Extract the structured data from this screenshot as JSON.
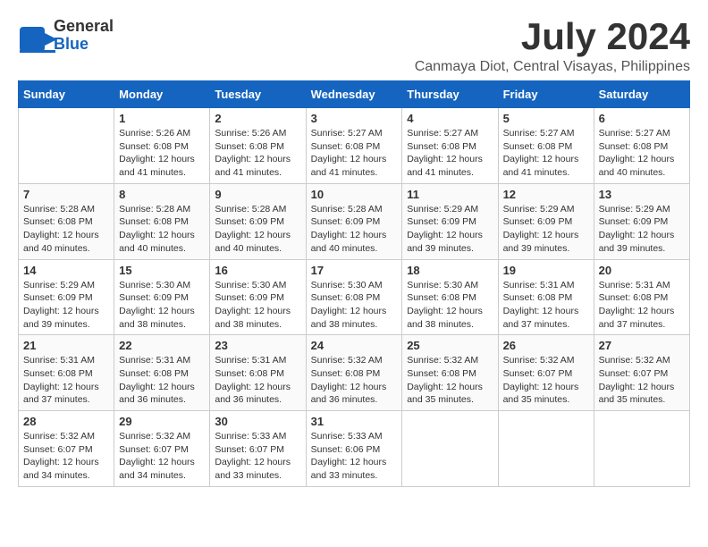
{
  "header": {
    "logo_general": "General",
    "logo_blue": "Blue",
    "month_title": "July 2024",
    "location": "Canmaya Diot, Central Visayas, Philippines"
  },
  "calendar": {
    "days_of_week": [
      "Sunday",
      "Monday",
      "Tuesday",
      "Wednesday",
      "Thursday",
      "Friday",
      "Saturday"
    ],
    "weeks": [
      [
        {
          "day": "",
          "content": ""
        },
        {
          "day": "1",
          "content": "Sunrise: 5:26 AM\nSunset: 6:08 PM\nDaylight: 12 hours and 41 minutes."
        },
        {
          "day": "2",
          "content": "Sunrise: 5:26 AM\nSunset: 6:08 PM\nDaylight: 12 hours and 41 minutes."
        },
        {
          "day": "3",
          "content": "Sunrise: 5:27 AM\nSunset: 6:08 PM\nDaylight: 12 hours and 41 minutes."
        },
        {
          "day": "4",
          "content": "Sunrise: 5:27 AM\nSunset: 6:08 PM\nDaylight: 12 hours and 41 minutes."
        },
        {
          "day": "5",
          "content": "Sunrise: 5:27 AM\nSunset: 6:08 PM\nDaylight: 12 hours and 41 minutes."
        },
        {
          "day": "6",
          "content": "Sunrise: 5:27 AM\nSunset: 6:08 PM\nDaylight: 12 hours and 40 minutes."
        }
      ],
      [
        {
          "day": "7",
          "content": "Sunrise: 5:28 AM\nSunset: 6:08 PM\nDaylight: 12 hours and 40 minutes."
        },
        {
          "day": "8",
          "content": "Sunrise: 5:28 AM\nSunset: 6:08 PM\nDaylight: 12 hours and 40 minutes."
        },
        {
          "day": "9",
          "content": "Sunrise: 5:28 AM\nSunset: 6:09 PM\nDaylight: 12 hours and 40 minutes."
        },
        {
          "day": "10",
          "content": "Sunrise: 5:28 AM\nSunset: 6:09 PM\nDaylight: 12 hours and 40 minutes."
        },
        {
          "day": "11",
          "content": "Sunrise: 5:29 AM\nSunset: 6:09 PM\nDaylight: 12 hours and 39 minutes."
        },
        {
          "day": "12",
          "content": "Sunrise: 5:29 AM\nSunset: 6:09 PM\nDaylight: 12 hours and 39 minutes."
        },
        {
          "day": "13",
          "content": "Sunrise: 5:29 AM\nSunset: 6:09 PM\nDaylight: 12 hours and 39 minutes."
        }
      ],
      [
        {
          "day": "14",
          "content": "Sunrise: 5:29 AM\nSunset: 6:09 PM\nDaylight: 12 hours and 39 minutes."
        },
        {
          "day": "15",
          "content": "Sunrise: 5:30 AM\nSunset: 6:09 PM\nDaylight: 12 hours and 38 minutes."
        },
        {
          "day": "16",
          "content": "Sunrise: 5:30 AM\nSunset: 6:09 PM\nDaylight: 12 hours and 38 minutes."
        },
        {
          "day": "17",
          "content": "Sunrise: 5:30 AM\nSunset: 6:08 PM\nDaylight: 12 hours and 38 minutes."
        },
        {
          "day": "18",
          "content": "Sunrise: 5:30 AM\nSunset: 6:08 PM\nDaylight: 12 hours and 38 minutes."
        },
        {
          "day": "19",
          "content": "Sunrise: 5:31 AM\nSunset: 6:08 PM\nDaylight: 12 hours and 37 minutes."
        },
        {
          "day": "20",
          "content": "Sunrise: 5:31 AM\nSunset: 6:08 PM\nDaylight: 12 hours and 37 minutes."
        }
      ],
      [
        {
          "day": "21",
          "content": "Sunrise: 5:31 AM\nSunset: 6:08 PM\nDaylight: 12 hours and 37 minutes."
        },
        {
          "day": "22",
          "content": "Sunrise: 5:31 AM\nSunset: 6:08 PM\nDaylight: 12 hours and 36 minutes."
        },
        {
          "day": "23",
          "content": "Sunrise: 5:31 AM\nSunset: 6:08 PM\nDaylight: 12 hours and 36 minutes."
        },
        {
          "day": "24",
          "content": "Sunrise: 5:32 AM\nSunset: 6:08 PM\nDaylight: 12 hours and 36 minutes."
        },
        {
          "day": "25",
          "content": "Sunrise: 5:32 AM\nSunset: 6:08 PM\nDaylight: 12 hours and 35 minutes."
        },
        {
          "day": "26",
          "content": "Sunrise: 5:32 AM\nSunset: 6:07 PM\nDaylight: 12 hours and 35 minutes."
        },
        {
          "day": "27",
          "content": "Sunrise: 5:32 AM\nSunset: 6:07 PM\nDaylight: 12 hours and 35 minutes."
        }
      ],
      [
        {
          "day": "28",
          "content": "Sunrise: 5:32 AM\nSunset: 6:07 PM\nDaylight: 12 hours and 34 minutes."
        },
        {
          "day": "29",
          "content": "Sunrise: 5:32 AM\nSunset: 6:07 PM\nDaylight: 12 hours and 34 minutes."
        },
        {
          "day": "30",
          "content": "Sunrise: 5:33 AM\nSunset: 6:07 PM\nDaylight: 12 hours and 33 minutes."
        },
        {
          "day": "31",
          "content": "Sunrise: 5:33 AM\nSunset: 6:06 PM\nDaylight: 12 hours and 33 minutes."
        },
        {
          "day": "",
          "content": ""
        },
        {
          "day": "",
          "content": ""
        },
        {
          "day": "",
          "content": ""
        }
      ]
    ]
  }
}
